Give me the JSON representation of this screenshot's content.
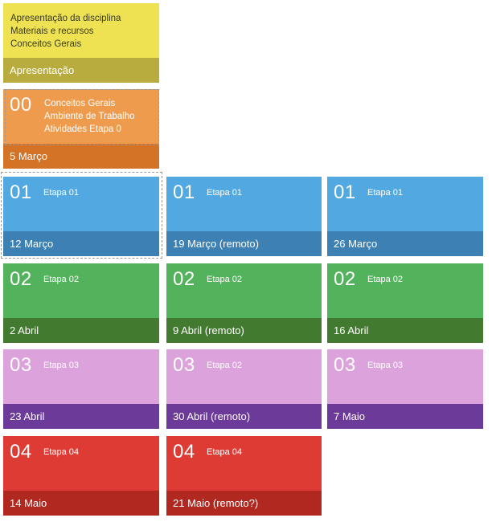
{
  "intro": {
    "lines": [
      "Apresentação da disciplina",
      "Materiais e recursos",
      "Conceitos Gerais"
    ],
    "footer": "Apresentação",
    "color": "#eee253",
    "footer_color": "#b8ac3f"
  },
  "stage0": {
    "number": "00",
    "lines": [
      "Conceitos Gerais",
      "Ambiente de Trabalho",
      "Atividades Etapa 0"
    ],
    "date": "5 Março",
    "color": "#ee9b4d",
    "footer_color": "#d47325"
  },
  "tiles": [
    {
      "number": "01",
      "stage": "Etapa 01",
      "date": "12 Março",
      "color": "#52a8e0",
      "footer_color": "#3d81b4"
    },
    {
      "number": "01",
      "stage": "Etapa 01",
      "date": "19 Março  (remoto)",
      "color": "#52a8e0",
      "footer_color": "#3d81b4"
    },
    {
      "number": "01",
      "stage": "Etapa 01",
      "date": "26 Março",
      "color": "#52a8e0",
      "footer_color": "#3d81b4"
    },
    {
      "number": "02",
      "stage": "Etapa 02",
      "date": "2 Abril",
      "color": "#53b25c",
      "footer_color": "#427a2f"
    },
    {
      "number": "02",
      "stage": "Etapa 02",
      "date": "9 Abril  (remoto)",
      "color": "#53b25c",
      "footer_color": "#427a2f"
    },
    {
      "number": "02",
      "stage": "Etapa 02",
      "date": "16 Abril",
      "color": "#53b25c",
      "footer_color": "#427a2f"
    },
    {
      "number": "03",
      "stage": "Etapa 03",
      "date": "23 Abril",
      "color": "#dca2dc",
      "footer_color": "#6c3a99"
    },
    {
      "number": "03",
      "stage": "Etapa 02",
      "date": "30 Abril (remoto)",
      "color": "#dca2dc",
      "footer_color": "#6c3a99"
    },
    {
      "number": "03",
      "stage": "Etapa 03",
      "date": "7 Maio",
      "color": "#dca2dc",
      "footer_color": "#6c3a99"
    },
    {
      "number": "04",
      "stage": "Etapa 04",
      "date": "14 Maio",
      "color": "#de3b35",
      "footer_color": "#b0281f"
    },
    {
      "number": "04",
      "stage": "Etapa 04",
      "date": "21 Maio (remoto?)",
      "color": "#de3b35",
      "footer_color": "#b0281f"
    }
  ]
}
